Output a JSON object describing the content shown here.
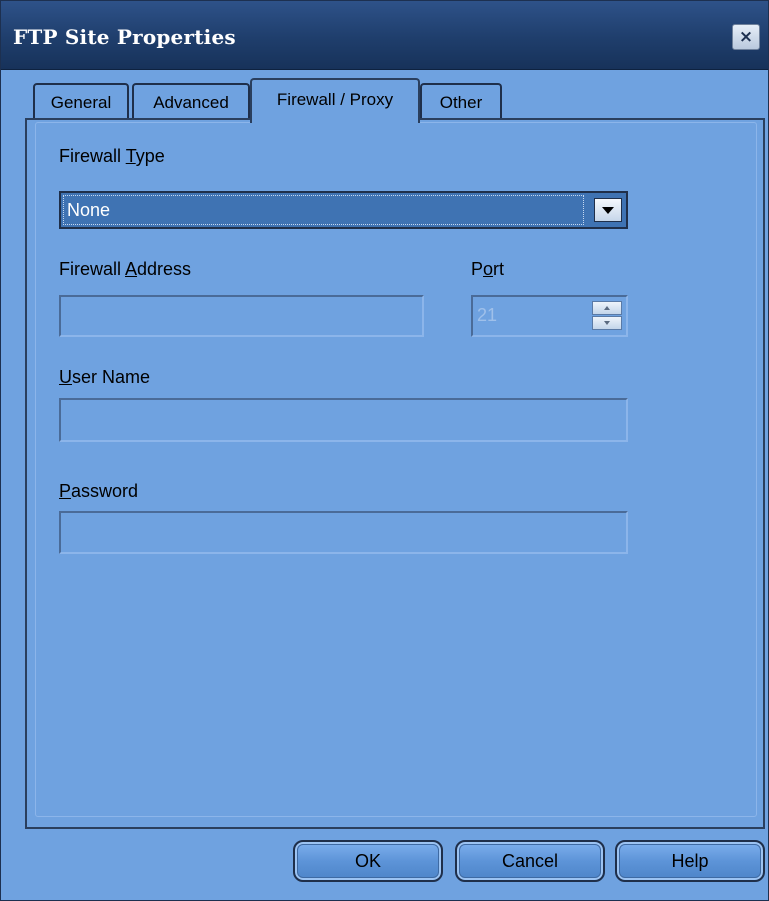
{
  "window": {
    "title": "FTP Site Properties",
    "close_label": "×"
  },
  "tabs": [
    {
      "label": "General",
      "selected": false
    },
    {
      "label": "Advanced",
      "selected": false
    },
    {
      "label": "Firewall / Proxy",
      "selected": true
    },
    {
      "label": "Other",
      "selected": false
    }
  ],
  "form": {
    "firewall_type": {
      "label_pre": "Firewall ",
      "label_key": "T",
      "label_post": "ype",
      "value": "None"
    },
    "firewall_address": {
      "label_pre": "Firewall ",
      "label_key": "A",
      "label_post": "ddress",
      "value": ""
    },
    "port": {
      "label_pre": "P",
      "label_key": "o",
      "label_post": "rt",
      "value": "21"
    },
    "user_name": {
      "label_pre": "",
      "label_key": "U",
      "label_post": "ser Name",
      "value": ""
    },
    "password": {
      "label_pre": "",
      "label_key": "P",
      "label_post": "assword",
      "value": ""
    }
  },
  "buttons": {
    "ok": "OK",
    "cancel": "Cancel",
    "help": "Help"
  },
  "colors": {
    "titlebar": "#1f3e6c",
    "dialog_background": "#6fa2e0",
    "selected_dropdown": "#3f73b3"
  }
}
